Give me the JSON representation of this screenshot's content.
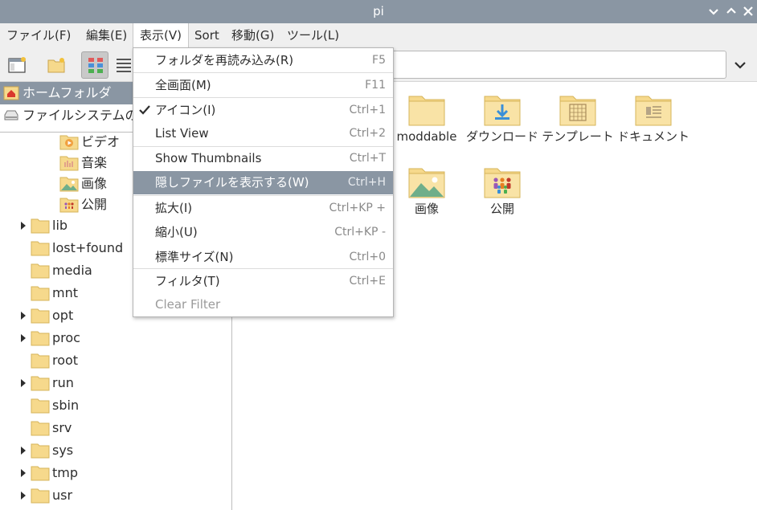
{
  "window": {
    "title": "pi"
  },
  "menubar": {
    "items": [
      {
        "label": "ファイル(F)"
      },
      {
        "label": "編集(E)"
      },
      {
        "label": "表示(V)"
      },
      {
        "label": "Sort"
      },
      {
        "label": "移動(G)"
      },
      {
        "label": "ツール(L)"
      }
    ],
    "active_index": 2
  },
  "view_menu": {
    "items": [
      {
        "label": "フォルダを再読み込み(R)",
        "shortcut": "F5"
      },
      {
        "label": "全画面(M)",
        "shortcut": "F11"
      },
      {
        "label": "アイコン(I)",
        "shortcut": "Ctrl+1",
        "checked": true
      },
      {
        "label": "List View",
        "shortcut": "Ctrl+2"
      },
      {
        "label": "Show Thumbnails",
        "shortcut": "Ctrl+T"
      },
      {
        "label": "隠しファイルを表示する(W)",
        "shortcut": "Ctrl+H",
        "highlighted": true
      },
      {
        "label": "拡大(I)",
        "shortcut": "Ctrl+KP +"
      },
      {
        "label": "縮小(U)",
        "shortcut": "Ctrl+KP -"
      },
      {
        "label": "標準サイズ(N)",
        "shortcut": "Ctrl+0"
      },
      {
        "label": "フィルタ(T)",
        "shortcut": "Ctrl+E"
      },
      {
        "label": "Clear Filter",
        "shortcut": "",
        "disabled": true
      }
    ]
  },
  "sidebar": {
    "places": [
      {
        "label": "ホームフォルダ",
        "icon": "home-icon",
        "selected": true
      },
      {
        "label": "ファイルシステムのルート",
        "icon": "drive-icon",
        "selected": false
      }
    ],
    "tree": [
      {
        "label": "ビデオ",
        "icon": "video-folder-icon",
        "expandable": false
      },
      {
        "label": "音楽",
        "icon": "music-folder-icon",
        "expandable": false
      },
      {
        "label": "画像",
        "icon": "pictures-folder-icon",
        "expandable": false
      },
      {
        "label": "公開",
        "icon": "public-folder-icon",
        "expandable": false
      },
      {
        "label": "lib",
        "icon": "folder-icon",
        "expandable": true
      },
      {
        "label": "lost+found",
        "icon": "folder-icon",
        "expandable": false
      },
      {
        "label": "media",
        "icon": "folder-icon",
        "expandable": false
      },
      {
        "label": "mnt",
        "icon": "folder-icon",
        "expandable": false
      },
      {
        "label": "opt",
        "icon": "folder-icon",
        "expandable": true
      },
      {
        "label": "proc",
        "icon": "folder-icon",
        "expandable": true
      },
      {
        "label": "root",
        "icon": "folder-icon",
        "expandable": false
      },
      {
        "label": "run",
        "icon": "folder-icon",
        "expandable": true
      },
      {
        "label": "sbin",
        "icon": "folder-icon",
        "expandable": false
      },
      {
        "label": "srv",
        "icon": "folder-icon",
        "expandable": false
      },
      {
        "label": "sys",
        "icon": "folder-icon",
        "expandable": true
      },
      {
        "label": "tmp",
        "icon": "folder-icon",
        "expandable": true
      },
      {
        "label": "usr",
        "icon": "folder-icon",
        "expandable": true
      }
    ]
  },
  "files": [
    {
      "label": "moddable",
      "icon": "folder-icon"
    },
    {
      "label": "ダウンロード",
      "icon": "download-folder-icon"
    },
    {
      "label": "テンプレート",
      "icon": "templates-folder-icon"
    },
    {
      "label": "ドキュメント",
      "icon": "documents-folder-icon"
    },
    {
      "label": "画像",
      "icon": "pictures-folder-icon"
    },
    {
      "label": "公開",
      "icon": "public-folder-icon"
    }
  ],
  "colors": {
    "accent": "#8a96a3",
    "folder": "#f6d98c",
    "folder_tab": "#e8c56e"
  }
}
